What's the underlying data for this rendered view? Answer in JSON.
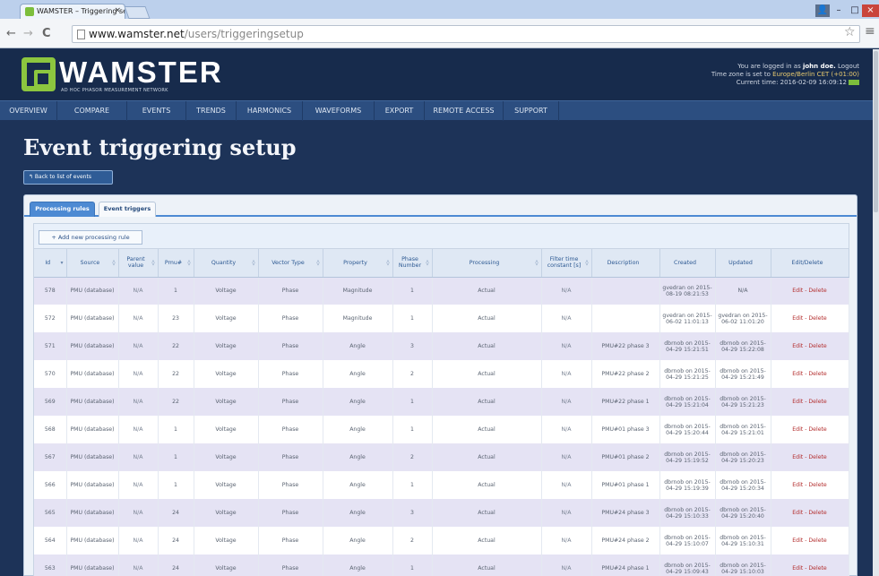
{
  "browser": {
    "tab_title": "WAMSTER – Triggering se",
    "tab_close": "×",
    "url_domain": "www.wamster.net",
    "url_path": "/users/triggeringsetup",
    "back_glyph": "←",
    "forward_glyph": "→",
    "reload_glyph": "C",
    "star_glyph": "☆",
    "menu_glyph": "≡",
    "win_user": "👤",
    "win_min": "–",
    "win_max": "□",
    "win_close": "×"
  },
  "header": {
    "logo_text": "WAMSTER",
    "logo_subtitle": "AD HOC PHASOR MEASUREMENT NETWORK",
    "login_prefix": "You are logged in as",
    "login_user": "john doe.",
    "logout": "Logout",
    "tz_prefix": "Time zone is set to",
    "tz_value": "Europe/Berlin CET (+01:00)",
    "current_time": "Current time: 2016-02-09 16:09:12"
  },
  "nav": {
    "items": [
      "OVERVIEW",
      "COMPARE",
      "EVENTS",
      "TRENDS",
      "HARMONICS",
      "WAVEFORMS",
      "EXPORT",
      "REMOTE ACCESS",
      "SUPPORT"
    ]
  },
  "page": {
    "title": "Event triggering setup",
    "back_button": "↰ Back to list of events"
  },
  "tabs": {
    "processing": "Processing rules",
    "triggers": "Event triggers"
  },
  "add_button": "+ Add new processing rule",
  "table": {
    "columns": [
      "Id",
      "Source",
      "Parent value",
      "Pmu#",
      "Quantity",
      "Vector Type",
      "Property",
      "Phase Number",
      "Processing",
      "Filter time constant [s]",
      "Description",
      "Created",
      "Updated",
      "Edit/Delete"
    ],
    "rows": [
      [
        "578",
        "PMU (database)",
        "N/A",
        "1",
        "Voltage",
        "Phase",
        "Magnitude",
        "1",
        "Actual",
        "N/A",
        "",
        "gvedran on 2015-08-19 08:21:53",
        "N/A",
        "Edit - Delete"
      ],
      [
        "572",
        "PMU (database)",
        "N/A",
        "23",
        "Voltage",
        "Phase",
        "Magnitude",
        "1",
        "Actual",
        "N/A",
        "",
        "gvedran on 2015-06-02 11:01:13",
        "gvedran on 2015-06-02 11:01:20",
        "Edit - Delete"
      ],
      [
        "571",
        "PMU (database)",
        "N/A",
        "22",
        "Voltage",
        "Phase",
        "Angle",
        "3",
        "Actual",
        "N/A",
        "PMU#22 phase 3",
        "dbrnob on 2015-04-29 15:21:51",
        "dbrnob on 2015-04-29 15:22:08",
        "Edit - Delete"
      ],
      [
        "570",
        "PMU (database)",
        "N/A",
        "22",
        "Voltage",
        "Phase",
        "Angle",
        "2",
        "Actual",
        "N/A",
        "PMU#22 phase 2",
        "dbrnob on 2015-04-29 15:21:25",
        "dbrnob on 2015-04-29 15:21:49",
        "Edit - Delete"
      ],
      [
        "569",
        "PMU (database)",
        "N/A",
        "22",
        "Voltage",
        "Phase",
        "Angle",
        "1",
        "Actual",
        "N/A",
        "PMU#22 phase 1",
        "dbrnob on 2015-04-29 15:21:04",
        "dbrnob on 2015-04-29 15:21:23",
        "Edit - Delete"
      ],
      [
        "568",
        "PMU (database)",
        "N/A",
        "1",
        "Voltage",
        "Phase",
        "Angle",
        "1",
        "Actual",
        "N/A",
        "PMU#01 phase 3",
        "dbrnob on 2015-04-29 15:20:44",
        "dbrnob on 2015-04-29 15:21:01",
        "Edit - Delete"
      ],
      [
        "567",
        "PMU (database)",
        "N/A",
        "1",
        "Voltage",
        "Phase",
        "Angle",
        "2",
        "Actual",
        "N/A",
        "PMU#01 phase 2",
        "dbrnob on 2015-04-29 15:19:52",
        "dbrnob on 2015-04-29 15:20:23",
        "Edit - Delete"
      ],
      [
        "566",
        "PMU (database)",
        "N/A",
        "1",
        "Voltage",
        "Phase",
        "Angle",
        "1",
        "Actual",
        "N/A",
        "PMU#01 phase 1",
        "dbrnob on 2015-04-29 15:19:39",
        "dbrnob on 2015-04-29 15:20:34",
        "Edit - Delete"
      ],
      [
        "565",
        "PMU (database)",
        "N/A",
        "24",
        "Voltage",
        "Phase",
        "Angle",
        "3",
        "Actual",
        "N/A",
        "PMU#24 phase 3",
        "dbrnob on 2015-04-29 15:10:33",
        "dbrnob on 2015-04-29 15:20:40",
        "Edit - Delete"
      ],
      [
        "564",
        "PMU (database)",
        "N/A",
        "24",
        "Voltage",
        "Phase",
        "Angle",
        "2",
        "Actual",
        "N/A",
        "PMU#24 phase 2",
        "dbrnob on 2015-04-29 15:10:07",
        "dbrnob on 2015-04-29 15:10:31",
        "Edit - Delete"
      ],
      [
        "563",
        "PMU (database)",
        "N/A",
        "24",
        "Voltage",
        "Phase",
        "Angle",
        "1",
        "Actual",
        "N/A",
        "PMU#24 phase 1",
        "dbrnob on 2015-04-29 15:09:43",
        "dbrnob on 2015-04-29 15:10:03",
        "Edit - Delete"
      ]
    ]
  },
  "colors": {
    "page_bg": "#1d3358",
    "accent": "#4d8ad3",
    "logo_green": "#8cc63f",
    "odd_row": "#e5e3f4",
    "delete_red": "#b32d2d"
  }
}
